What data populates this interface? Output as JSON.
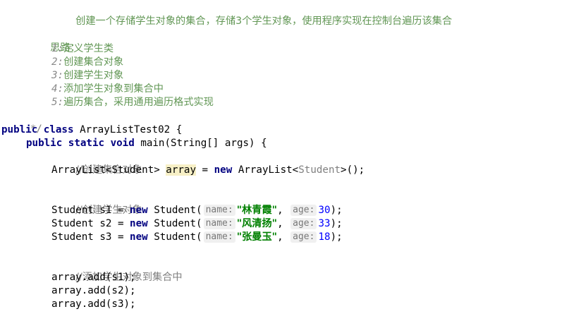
{
  "editor": {
    "doc": {
      "description": "创建一个存储学生对象的集合，存储3个学生对象，使用程序实现在控制台遍历该集合",
      "ideas_title": "思路：",
      "steps": [
        {
          "num": "1:",
          "text": "定义学生类"
        },
        {
          "num": "2:",
          "text": "创建集合对象"
        },
        {
          "num": "3:",
          "text": "创建学生对象"
        },
        {
          "num": "4:",
          "text": "添加学生对象到集合中"
        },
        {
          "num": "5:",
          "text": "遍历集合，采用通用遍历格式实现"
        }
      ],
      "end": " */"
    },
    "class_decl": {
      "kw_public": "public",
      "kw_class": "class",
      "name": "ArrayListTest02 {"
    },
    "method_decl": {
      "kw_public": "public",
      "kw_static": "static",
      "kw_void": "void",
      "signature": "main(String[] args) {"
    },
    "comments": {
      "create_collection": "//创建集合对象",
      "create_students": "//创建学生对象",
      "add_students": "//添加学生对象到集合中"
    },
    "collection_line": {
      "type": "ArrayList<Student>",
      "var": "array",
      "assign": " = ",
      "kw_new": "new",
      "ctor": "ArrayList<",
      "generic": "Student",
      "end": ">();"
    },
    "students": [
      {
        "decl": "Student s1 = ",
        "kw_new": "new",
        "ctor": "Student(",
        "name_hint": "name:",
        "name": "\"林青霞\"",
        "age_hint": "age:",
        "age": "30",
        "end": ");"
      },
      {
        "decl": "Student s2 = ",
        "kw_new": "new",
        "ctor": "Student(",
        "name_hint": "name:",
        "name": "\"风清扬\"",
        "age_hint": "age:",
        "age": "33",
        "end": ");"
      },
      {
        "decl": "Student s3 = ",
        "kw_new": "new",
        "ctor": "Student(",
        "name_hint": "name:",
        "name": "\"张曼玉\"",
        "age_hint": "age:",
        "age": "18",
        "end": ");"
      }
    ],
    "add_calls": [
      "array.add(s1);",
      "array.add(s2);",
      "array.add(s3);"
    ]
  }
}
